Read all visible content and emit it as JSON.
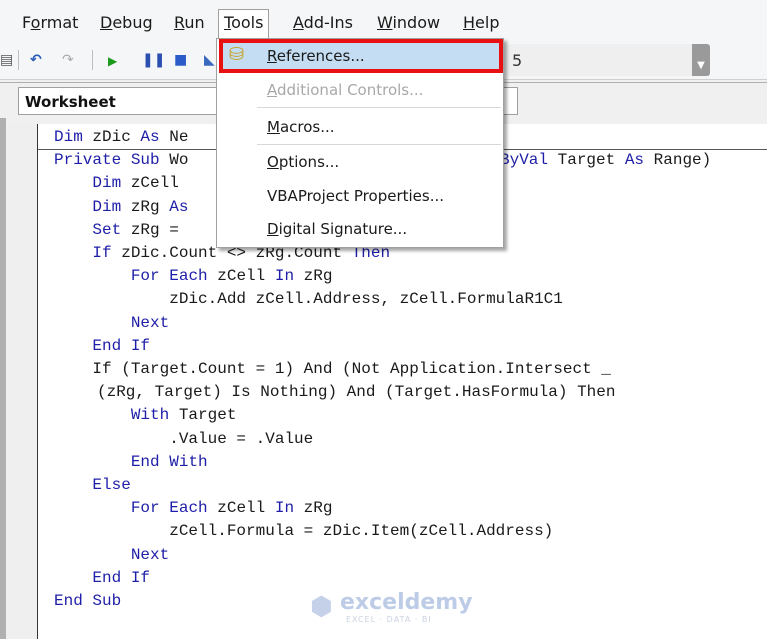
{
  "menubar": {
    "items": [
      {
        "label": "Format",
        "accel": "o"
      },
      {
        "label": "Debug",
        "accel": "D"
      },
      {
        "label": "Run",
        "accel": "R"
      },
      {
        "label": "Tools",
        "accel": "T",
        "open": true
      },
      {
        "label": "Add-Ins",
        "accel": "A"
      },
      {
        "label": "Window",
        "accel": "W"
      },
      {
        "label": "Help",
        "accel": "H"
      }
    ]
  },
  "toolbar": {
    "icons": [
      "print-icon",
      "undo-icon",
      "redo-icon",
      "run-icon",
      "pause-icon",
      "stop-icon",
      "design-mode-icon"
    ],
    "combo_value": "5"
  },
  "object_box": {
    "value": "Worksheet"
  },
  "tools_menu": {
    "items": [
      {
        "label": "References...",
        "highlighted": true,
        "enabled": true
      },
      {
        "label": "Additional Controls...",
        "enabled": false
      },
      {
        "label": "Macros...",
        "enabled": true
      },
      {
        "label": "Options...",
        "enabled": true
      },
      {
        "label": "VBAProject Properties...",
        "enabled": true
      },
      {
        "label": "Digital Signature...",
        "enabled": true
      }
    ]
  },
  "code": {
    "lines": [
      "Dim zDic As Ne",
      "Private Sub Wo",
      "    Dim zCell",
      "    Dim zRg As",
      "    Set zRg =",
      "    If zDic.Count <> zRg.Count Then",
      "        For Each zCell In zRg",
      "            zDic.Add zCell.Address, zCell.FormulaR1C1",
      "        Next",
      "    End If",
      "    If (Target.Count = 1) And (Not Application.Intersect _",
      "    (zRg, Target) Is Nothing) And (Target.HasFormula) Then",
      "        With Target",
      "            .Value = .Value",
      "        End With",
      "    Else",
      "        For Each zCell In zRg",
      "            zCell.Formula = zDic.Item(zCell.Address)",
      "        Next",
      "    End If",
      "End Sub"
    ],
    "line1_tail": "ByVal Target As Range)"
  },
  "watermark": {
    "brand": "exceldemy",
    "tagline": "EXCEL · DATA · BI"
  },
  "colors": {
    "keyword": "#1e1ea8",
    "highlight_border": "#e81010",
    "highlight_fill": "#c4ddf3"
  }
}
